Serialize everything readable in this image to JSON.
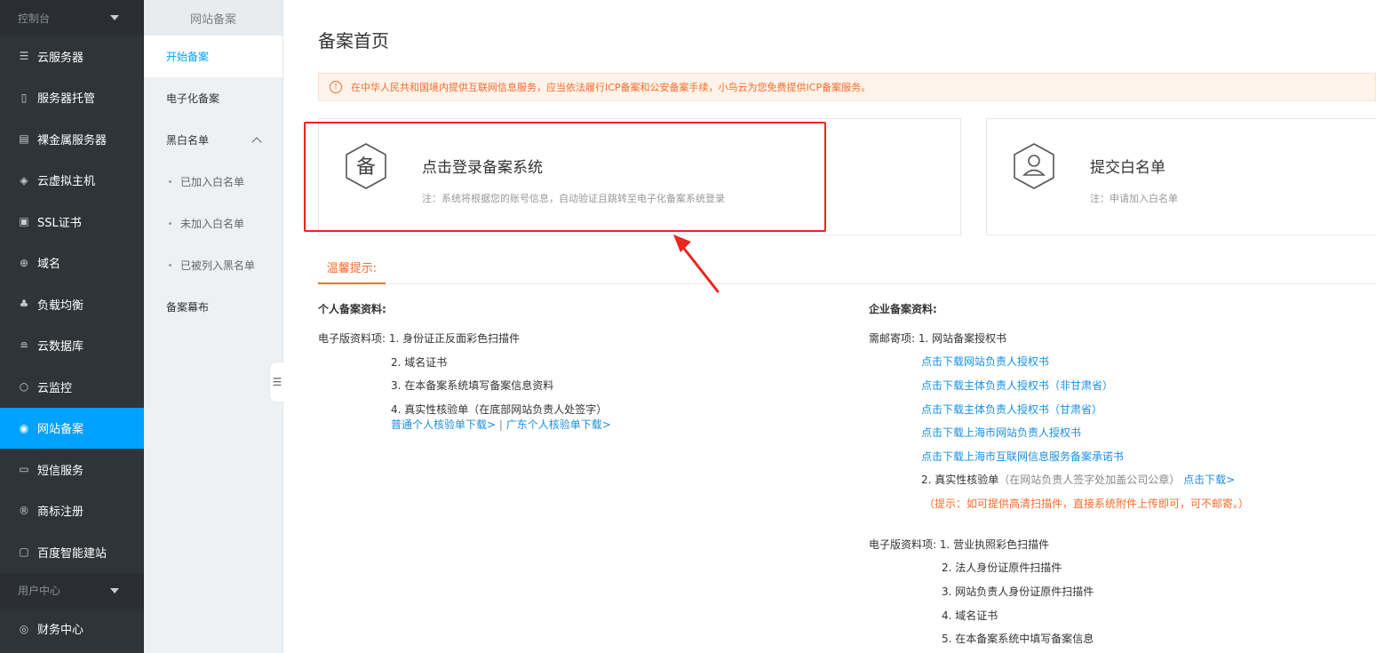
{
  "sidebar": {
    "console_label": "控制台",
    "items": [
      {
        "label": "云服务器",
        "icon": "server-list-icon"
      },
      {
        "label": "服务器托管",
        "icon": "rack-icon"
      },
      {
        "label": "裸金属服务器",
        "icon": "grid-server-icon"
      },
      {
        "label": "云虚拟主机",
        "icon": "cube-icon"
      },
      {
        "label": "SSL证书",
        "icon": "certificate-icon"
      },
      {
        "label": "域名",
        "icon": "globe-icon"
      },
      {
        "label": "负载均衡",
        "icon": "balance-icon"
      },
      {
        "label": "云数据库",
        "icon": "database-icon"
      },
      {
        "label": "云监控",
        "icon": "monitor-icon"
      },
      {
        "label": "网站备案",
        "icon": "record-icon"
      },
      {
        "label": "短信服务",
        "icon": "message-icon"
      },
      {
        "label": "商标注册",
        "icon": "trademark-icon"
      },
      {
        "label": "百度智能建站",
        "icon": "site-builder-icon"
      }
    ],
    "user_center_label": "用户中心",
    "finance_label": "财务中心"
  },
  "subnav": {
    "title": "网站备案",
    "start": "开始备案",
    "electronic": "电子化备案",
    "blackwhite": "黑白名单",
    "sub1": "已加入白名单",
    "sub2": "未加入白名单",
    "sub3": "已被列入黑名单",
    "curtain": "备案幕布"
  },
  "main": {
    "title": "备案首页",
    "notice": "在中华人民共和国境内提供互联网信息服务，应当依法履行ICP备案和公安备案手续，小鸟云为您免费提供ICP备案服务。",
    "card1": {
      "badge": "备",
      "title": "点击登录备案系统",
      "note": "注：系统将根据您的账号信息，自动验证且跳转至电子化备案系统登录"
    },
    "card2": {
      "title": "提交白名单",
      "note": "注：申请加入白名单"
    },
    "tab": "温馨提示:",
    "personal": {
      "title": "个人备案资料:",
      "label": "电子版资料项:",
      "items": [
        "1. 身份证正反面彩色扫描件",
        "2. 域名证书",
        "3. 在本备案系统填写备案信息资料",
        "4. 真实性核验单"
      ],
      "item4_note": "（在底部网站负责人处签字）",
      "link1": "普通个人核验单下载>",
      "sep": "|",
      "link2": "广东个人核验单下载>"
    },
    "enterprise": {
      "title": "企业备案资料:",
      "mail_label": "需邮寄项:",
      "mail_item1": "1. 网站备案授权书",
      "links": [
        "点击下载网站负责人授权书",
        "点击下载主体负责人授权书（非甘肃省）",
        "点击下载主体负责人授权书（甘肃省）",
        "点击下载上海市网站负责人授权书",
        "点击下载上海市互联网信息服务备案承诺书"
      ],
      "mail_item2": "2. 真实性核验单",
      "mail_item2_note": "（在网站负责人签字处加盖公司公章）",
      "mail_item2_link": "点击下载>",
      "tip": "（提示：如可提供高清扫描件，直接系统附件上传即可，可不邮寄。）",
      "elec_label": "电子版资料项:",
      "elec_items": [
        "1. 营业执照彩色扫描件",
        "2. 法人身份证原件扫描件",
        "3. 网站负责人身份证原件扫描件",
        "4. 域名证书",
        "5. 在本备案系统中填写备案信息"
      ]
    }
  },
  "colors": {
    "accent": "#00a2ff",
    "warning": "#f56c2a",
    "highlight": "#e8251f",
    "link": "#1a8fe3"
  }
}
